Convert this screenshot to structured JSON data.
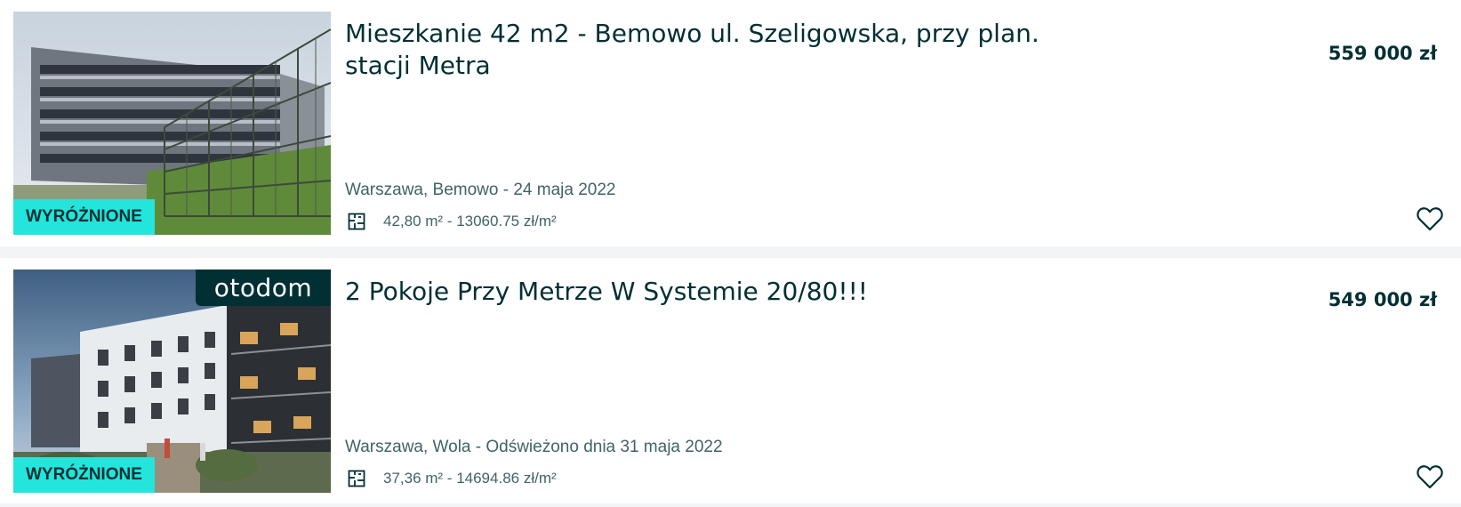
{
  "listings": [
    {
      "title": "Mieszkanie 42 m2 - Bemowo ul. Szeligowska, przy plan. stacji Metra",
      "price": "559 000 zł",
      "location": "Warszawa, Bemowo - 24 maja 2022",
      "area": "42,80 m² - 13060.75 zł/m²",
      "badge": "WYRÓŻNIONE",
      "brand": null
    },
    {
      "title": "2 Pokoje Przy Metrze W Systemie 20/80!!!",
      "price": "549 000 zł",
      "location": "Warszawa, Wola - Odświeżono dnia 31 maja 2022",
      "area": "37,36 m² - 14694.86 zł/m²",
      "badge": "WYRÓŻNIONE",
      "brand": "otodom"
    }
  ],
  "colors": {
    "badge_bg": "#23e5db",
    "text_primary": "#002f34",
    "text_secondary": "#406367",
    "brand_bg": "#002f34"
  },
  "icons": [
    "floor-plan-icon",
    "heart-outline-icon"
  ]
}
